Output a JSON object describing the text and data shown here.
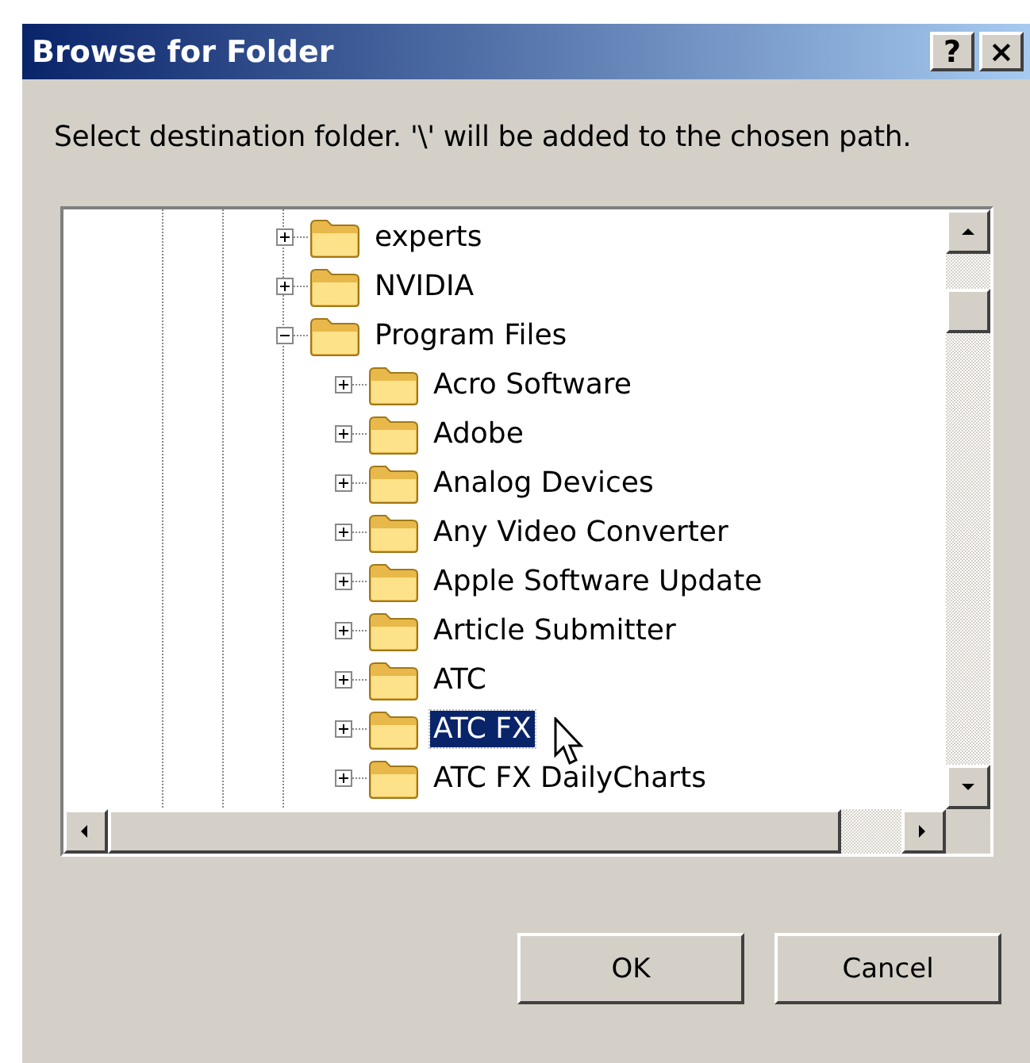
{
  "window": {
    "title": "Browse for Folder",
    "title_buttons": [
      "?",
      "×"
    ]
  },
  "instruction": "Select destination folder. '\\' will be added to the chosen path.",
  "tree": [
    {
      "label": "experts",
      "expanded": false,
      "selected": false
    },
    {
      "label": "NVIDIA",
      "expanded": false,
      "selected": false
    },
    {
      "label": "Program Files",
      "expanded": true,
      "selected": false,
      "children": [
        {
          "label": "Acro Software",
          "expanded": false,
          "selected": false
        },
        {
          "label": "Adobe",
          "expanded": false,
          "selected": false
        },
        {
          "label": "Analog Devices",
          "expanded": false,
          "selected": false
        },
        {
          "label": "Any Video Converter",
          "expanded": false,
          "selected": false
        },
        {
          "label": "Apple Software Update",
          "expanded": false,
          "selected": false
        },
        {
          "label": "Article Submitter",
          "expanded": false,
          "selected": false
        },
        {
          "label": "ATC",
          "expanded": false,
          "selected": false
        },
        {
          "label": "ATC FX",
          "expanded": false,
          "selected": true
        },
        {
          "label": "ATC FX DailyCharts",
          "expanded": false,
          "selected": false
        }
      ]
    }
  ],
  "buttons": [
    "OK",
    "Cancel"
  ]
}
